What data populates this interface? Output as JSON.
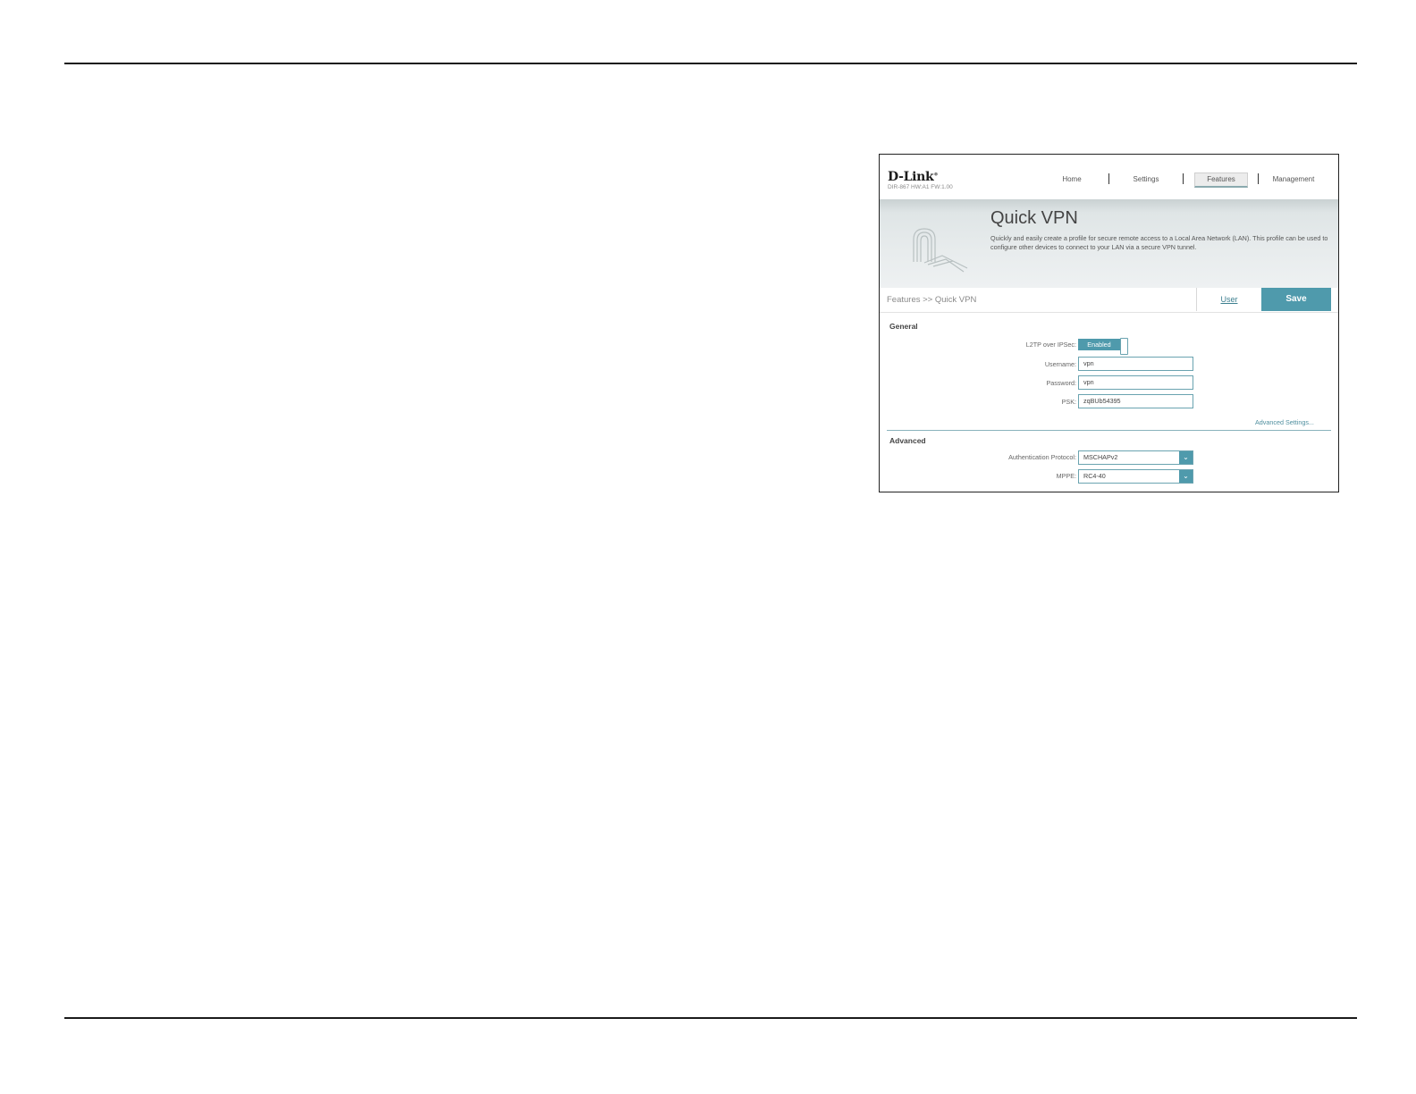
{
  "app": {
    "logo": "D-Link",
    "model": "DIR-867 HW:A1 FW:1.00"
  },
  "nav": {
    "home": "Home",
    "settings": "Settings",
    "features": "Features",
    "management": "Management"
  },
  "banner": {
    "title": "Quick VPN",
    "description": "Quickly and easily create a profile for secure remote access to a Local Area Network (LAN). This profile can be used to configure other devices to connect to your LAN via a secure VPN tunnel."
  },
  "breadcrumb": "Features >> Quick VPN",
  "actions": {
    "user": "User",
    "save": "Save"
  },
  "general": {
    "title": "General",
    "l2tp_label": "L2TP over IPSec:",
    "l2tp_value": "Enabled",
    "username_label": "Username:",
    "username_value": "vpn",
    "password_label": "Password:",
    "password_value": "vpn",
    "psk_label": "PSK:",
    "psk_value": "zqBUb54395",
    "advanced_link": "Advanced Settings..."
  },
  "advanced": {
    "title": "Advanced",
    "auth_label": "Authentication Protocol:",
    "auth_value": "MSCHAPv2",
    "mppe_label": "MPPE:",
    "mppe_value": "RC4-40"
  },
  "colors": {
    "accent": "#4f9aac",
    "link": "#3d7f8f"
  }
}
